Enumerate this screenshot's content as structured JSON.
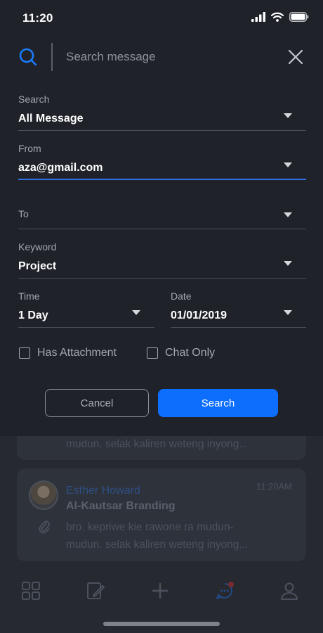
{
  "status_bar": {
    "time": "11:20"
  },
  "search": {
    "placeholder": "Search message"
  },
  "fields": {
    "search": {
      "label": "Search",
      "value": "All Message"
    },
    "from": {
      "label": "From",
      "value": "aza@gmail.com"
    },
    "to": {
      "label": "To",
      "value": ""
    },
    "keyword": {
      "label": "Keyword",
      "value": "Project"
    },
    "time": {
      "label": "Time",
      "value": "1 Day"
    },
    "date": {
      "label": "Date",
      "value": "01/01/2019"
    }
  },
  "options": {
    "has_attachment": {
      "label": "Has Attachment",
      "checked": false
    },
    "chat_only": {
      "label": "Chat Only",
      "checked": false
    }
  },
  "buttons": {
    "cancel": "Cancel",
    "search": "Search"
  },
  "background_messages": [
    {
      "preview": "mudun. selak kaliren weteng inyong..."
    },
    {
      "name": "Esther Howard",
      "time": "11:20AM",
      "subject": "Al-Kautsar Branding",
      "preview_line1": "bro. kepriwe kie rawone ra mudun-",
      "preview_line2": "mudun. selak kaliren weteng inyong..."
    }
  ],
  "tabs": [
    "grid-icon",
    "edit-icon",
    "plus-icon",
    "chat-icon",
    "profile-icon"
  ],
  "colors": {
    "accent": "#0d6efd",
    "sheet": "#1f2228",
    "background": "#262930",
    "chat_badge": "#e0404a"
  }
}
